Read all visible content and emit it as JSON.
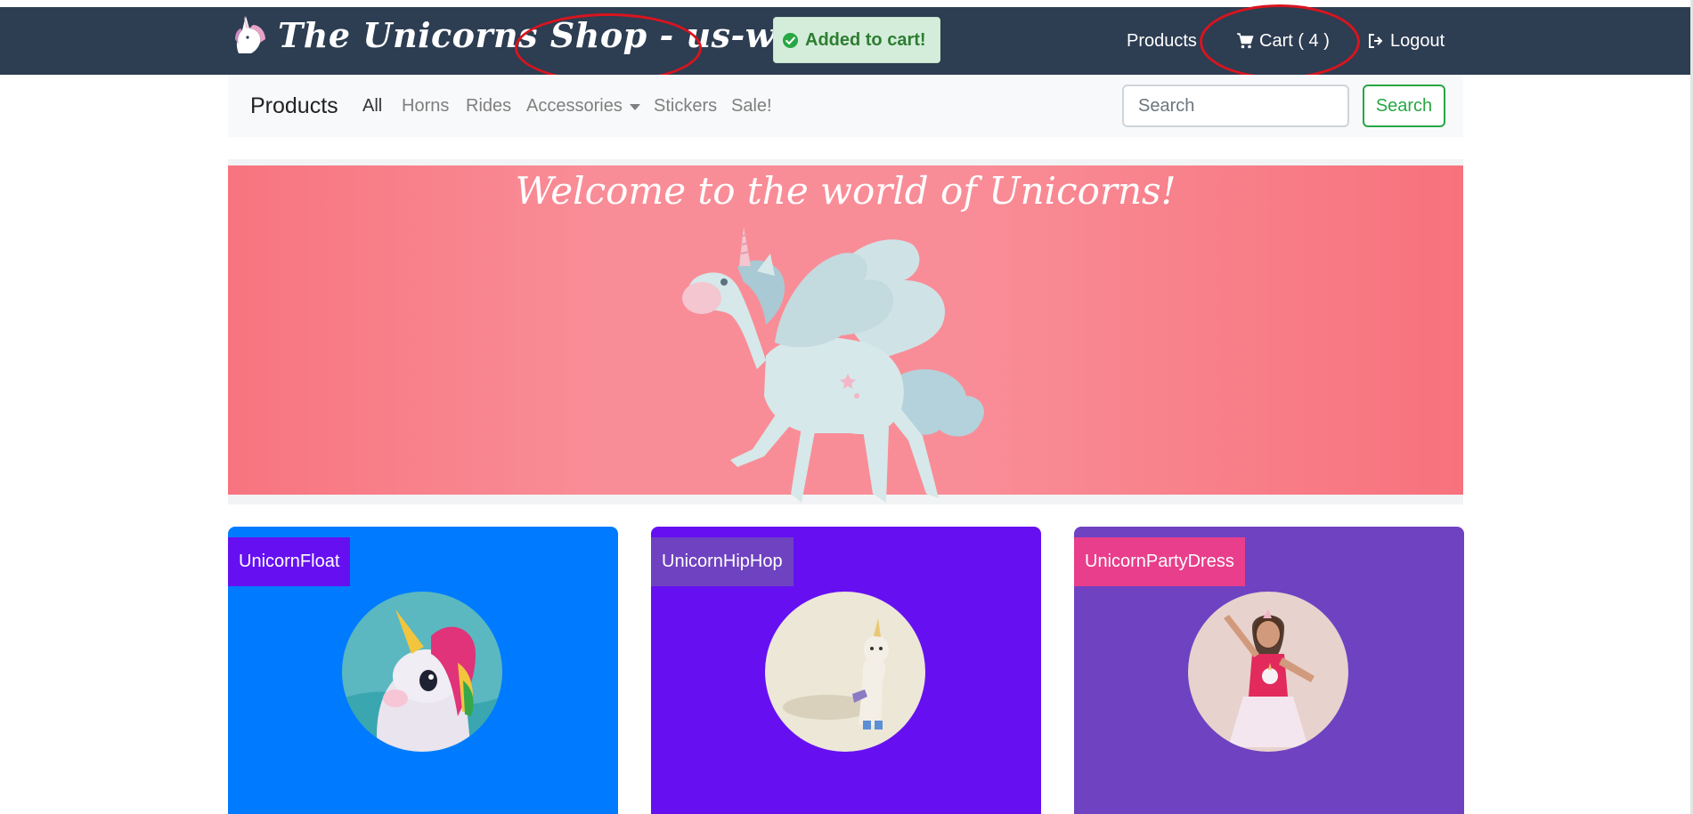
{
  "header": {
    "brand_title": "The Unicorns Shop - us-west-2",
    "toast_message": "Added to cart!",
    "nav_products": "Products",
    "nav_cart": "Cart ( 4 )",
    "nav_logout": "Logout",
    "toast_icon": "check-circle-icon",
    "cart_icon": "shopping-cart-icon",
    "logout_icon": "sign-out-icon"
  },
  "subnav": {
    "brand": "Products",
    "items": [
      {
        "label": "All",
        "active": true
      },
      {
        "label": "Horns",
        "active": false
      },
      {
        "label": "Rides",
        "active": false
      },
      {
        "label": "Accessories",
        "active": false,
        "dropdown": true
      },
      {
        "label": "Stickers",
        "active": false
      },
      {
        "label": "Sale!",
        "active": false
      }
    ],
    "search_placeholder": "Search",
    "search_button": "Search"
  },
  "hero": {
    "title": "Welcome to the world of Unicorns!"
  },
  "products": [
    {
      "name": "UnicornFloat",
      "card_color": "#007bff",
      "label_color": "#6610f2"
    },
    {
      "name": "UnicornHipHop",
      "card_color": "#6610f2",
      "label_color": "#6f42c1"
    },
    {
      "name": "UnicornPartyDress",
      "card_color": "#6f42c1",
      "label_color": "#e83e8c"
    }
  ],
  "colors": {
    "navbar": "#2d3d52",
    "annotation": "#d9141e",
    "hero": "#f7747f",
    "success": "#28a745"
  }
}
